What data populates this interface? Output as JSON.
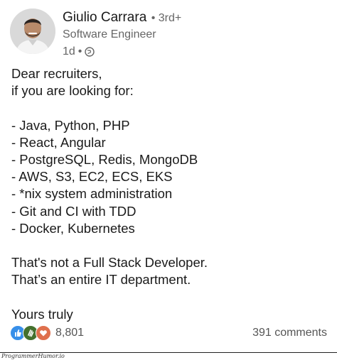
{
  "author": {
    "name": "Giulio Carrara",
    "degree": "• 3rd+",
    "headline": "Software Engineer",
    "time": "1d",
    "separator": "•",
    "visibility_icon": "globe-icon"
  },
  "post": {
    "lines": [
      "Dear recruiters,",
      "if you are looking for:",
      "",
      "- Java, Python, PHP",
      "- React, Angular",
      "- PostgreSQL, Redis, MongoDB",
      "- AWS, S3, EC2, ECS, EKS",
      "- *nix system administration",
      "- Git and CI with TDD",
      "- Docker, Kubernetes",
      "",
      "That's not a Full Stack Developer.",
      "That’s an entire IT department.",
      "",
      "Yours truly"
    ]
  },
  "social": {
    "reaction_icons": [
      "like-icon",
      "clap-icon",
      "love-icon"
    ],
    "reaction_colors": [
      "#378fe9",
      "#44712e",
      "#df704d"
    ],
    "reaction_count": "8,801",
    "comments": "391 comments"
  },
  "watermark": "ProgrammerHumor.io"
}
